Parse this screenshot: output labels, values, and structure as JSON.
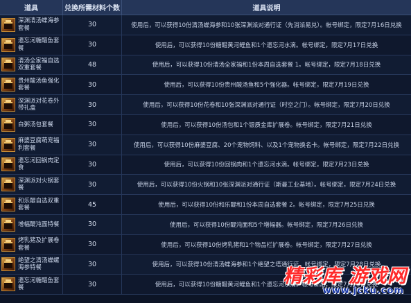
{
  "header": {
    "col_item": "道具",
    "col_qty": "兑换所需材料个数",
    "col_desc": "道具说明"
  },
  "rows": [
    {
      "name": "深渊清汤蝶海参套餐",
      "qty": "30",
      "desc": "使用后，可以获得10份清汤蝶海参和10张深渊派对通行证（先消派易兑）。帐号绑定，限定7月16日兑换"
    },
    {
      "name": "遗忘河糖醋鱼套餐",
      "qty": "30",
      "desc": "使用后，可以获得10份糖醋黄河鲤鱼和1个遗忘河水滴。帐号绑定，限定7月17日兑换"
    },
    {
      "name": "清汤全家福自选双重套餐",
      "qty": "48",
      "desc": "使用后，可以获得10份清汤全家福和1份本周自选套餐 1。帐号绑定，限定7月18日兑换"
    },
    {
      "name": "贵州酸汤鱼强化套餐",
      "qty": "30",
      "desc": "使用后，可以获得10份贵州酸汤鱼和5个强化器。帐号绑定，限定7月19日兑换"
    },
    {
      "name": "深渊派对花卷外带礼盒",
      "qty": "30",
      "desc": "使用后，可以获得10份花卷和10张深渊派对通行证（时空之门）。帐号绑定，限定7月20日兑换"
    },
    {
      "name": "白粥汤包套餐",
      "qty": "30",
      "desc": "使用后，可以获得10份汤包和1个银质金库扩展卷。帐号绑定，限定7月21日兑换"
    },
    {
      "name": "麻婆豆腐萌宠福利套餐",
      "qty": "30",
      "desc": "使用后，可以获得10份麻婆豆腐、20个宠物饲料、以及1个宠物换名卡。帐号绑定，限定7月22日兑换"
    },
    {
      "name": "遗忘河回锅肉定食",
      "qty": "30",
      "desc": "使用后，可以获得10份回锅肉和1个遗忘河水滴。帐号绑定，限定7月23日兑换"
    },
    {
      "name": "深渊派对火锅套餐",
      "qty": "30",
      "desc": "使用后，可以获得10份火锅和10张深渊派对通行证（斯曼工业基地）。帐号绑定，限定7月24日兑换"
    },
    {
      "name": "和乐醍自选双重套餐",
      "qty": "45",
      "desc": "使用后，可以获得10份和乐醍和1份本周自选套餐 2。帐号绑定，限定7月25日兑换"
    },
    {
      "name": "增幅醍沌面特餐",
      "qty": "30",
      "desc": "使用后，可以获得10份醍沌面和5个增幅器。帐号绑定，限定7月26日兑换"
    },
    {
      "name": "烤乳猪及扩展卷套餐",
      "qty": "30",
      "desc": "使用后，可以获得10份烤乳猪和1个物品栏扩展卷。帐号绑定，限定7月27日兑换"
    },
    {
      "name": "绝望之清汤蝶螺海参特餐",
      "qty": "30",
      "desc": "使用后，可以获得10份清汤蝶海参和1个绝望之塔通行证。帐号绑定，限定7月28日兑换"
    },
    {
      "name": "遗忘河糖醋鱼套餐",
      "qty": "30",
      "desc": "使用后，可以获得10份糖醋黄河鲤鱼和1个遗忘河水滴。帐号绑定，限定7月29日兑换"
    }
  ],
  "watermark": {
    "title": "精彩库 游戏网",
    "url": "www.jcku.com"
  }
}
